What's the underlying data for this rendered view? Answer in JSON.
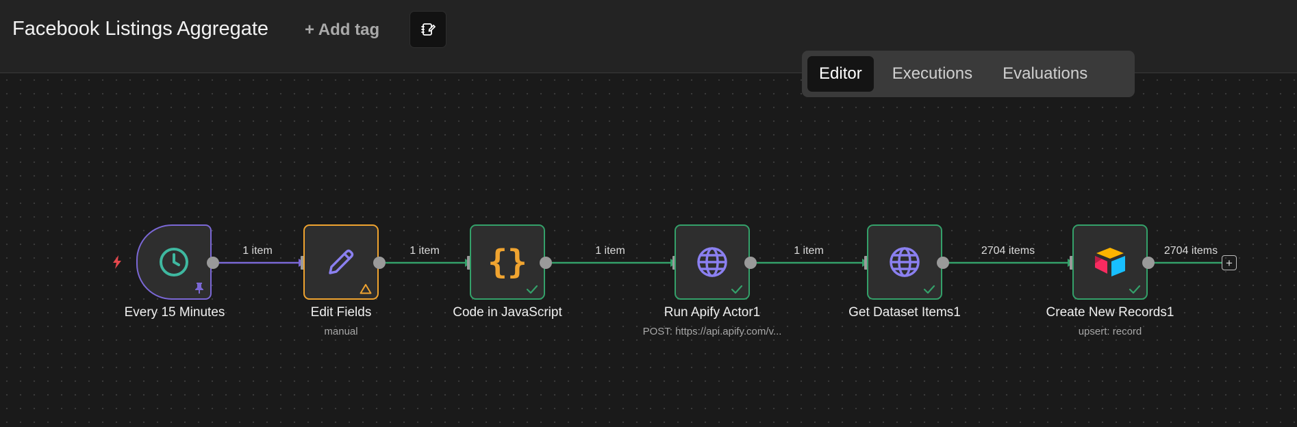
{
  "workflow": {
    "title": "Facebook Listings Aggregate",
    "add_tag_label": "+ Add tag"
  },
  "header": {
    "note_icon": "note-edit-icon"
  },
  "tabs": [
    {
      "label": "Editor",
      "active": true
    },
    {
      "label": "Executions",
      "active": false
    },
    {
      "label": "Evaluations",
      "active": false
    }
  ],
  "nodes": [
    {
      "label": "Every 15 Minutes",
      "sublabel": "",
      "icon": "clock-icon",
      "status": "pinned",
      "border": "#7b68d6"
    },
    {
      "label": "Edit Fields",
      "sublabel": "manual",
      "icon": "pencil-icon",
      "status": "warning",
      "border": "#f0a430"
    },
    {
      "label": "Code in JavaScript",
      "sublabel": "",
      "icon": "curly-braces-icon",
      "status": "success",
      "border": "#34a16a"
    },
    {
      "label": "Run Apify Actor1",
      "sublabel": "POST: https://api.apify.com/v...",
      "icon": "globe-icon",
      "status": "success",
      "border": "#34a16a"
    },
    {
      "label": "Get Dataset Items1",
      "sublabel": "",
      "icon": "globe-icon",
      "status": "success",
      "border": "#34a16a"
    },
    {
      "label": "Create New Records1",
      "sublabel": "upsert: record",
      "icon": "airtable-logo-icon",
      "status": "success",
      "border": "#34a16a"
    }
  ],
  "edges": [
    {
      "label": "1 item",
      "color": "#7b68d6"
    },
    {
      "label": "1 item",
      "color": "#34a16a"
    },
    {
      "label": "1 item",
      "color": "#34a16a"
    },
    {
      "label": "1 item",
      "color": "#34a16a"
    },
    {
      "label": "2704 items",
      "color": "#34a16a"
    },
    {
      "label": "2704 items",
      "color": "#34a16a"
    }
  ],
  "colors": {
    "success": "#34a16a",
    "trigger": "#7b68d6",
    "warning": "#f0a430",
    "error_bolt": "#e5484d",
    "globe": "#8b80f0",
    "clock": "#3fb8a0",
    "code": "#f0a430"
  }
}
